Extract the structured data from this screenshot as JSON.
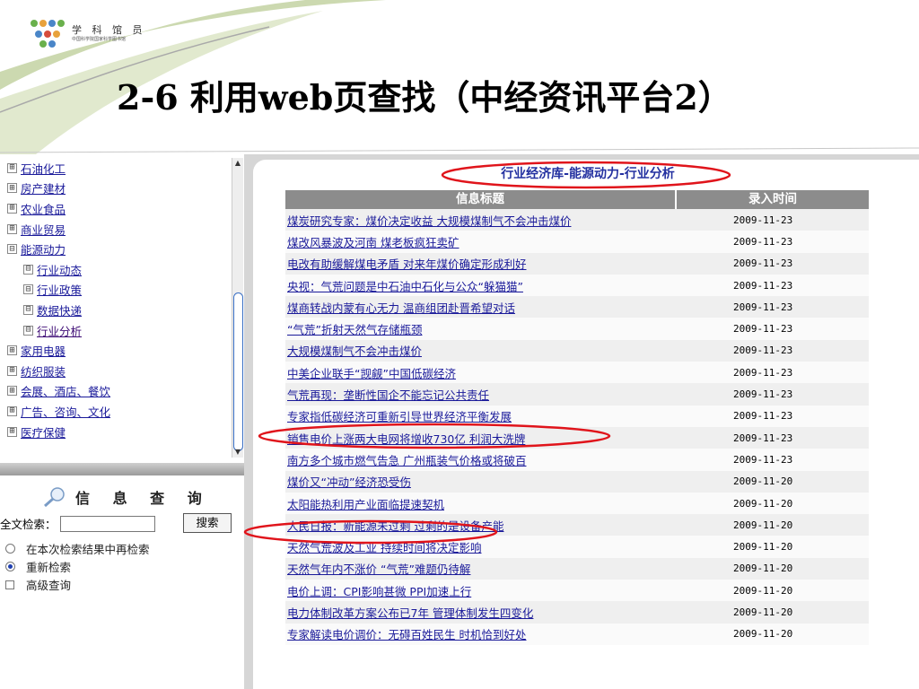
{
  "logo": {
    "title": "学 科 馆 员",
    "subtitle": "中国科学院国家科学图书馆"
  },
  "slide_title": "2-6 利用web页查找（中经资讯平台2）",
  "tree": [
    {
      "label": "石油化工",
      "toggle": "⊞",
      "level": 0
    },
    {
      "label": "房产建材",
      "toggle": "⊞",
      "level": 0
    },
    {
      "label": "农业食品",
      "toggle": "⊞",
      "level": 0
    },
    {
      "label": "商业贸易",
      "toggle": "⊞",
      "level": 0
    },
    {
      "label": "能源动力",
      "toggle": "⊟",
      "level": 0
    },
    {
      "label": "行业动态",
      "toggle": "⊟",
      "level": 1
    },
    {
      "label": "行业政策",
      "toggle": "⊟",
      "level": 1
    },
    {
      "label": "数据快递",
      "toggle": "⊟",
      "level": 1
    },
    {
      "label": "行业分析",
      "toggle": "⊟",
      "level": 1
    },
    {
      "label": "家用电器",
      "toggle": "⊞",
      "level": 0
    },
    {
      "label": "纺织服装",
      "toggle": "⊞",
      "level": 0
    },
    {
      "label": "会展、酒店、餐饮",
      "toggle": "⊞",
      "level": 0
    },
    {
      "label": "广告、咨询、文化",
      "toggle": "⊞",
      "level": 0
    },
    {
      "label": "医疗保健",
      "toggle": "⊞",
      "level": 0
    }
  ],
  "search": {
    "heading": "信 息 查 询",
    "label": "全文检索：",
    "value": "",
    "button": "搜索",
    "options": [
      "在本次检索结果中再检索",
      "重新检索",
      "高级查询"
    ]
  },
  "panel": {
    "title": "行业经济库-能源动力-行业分析"
  },
  "table": {
    "headers": [
      "信息标题",
      "录入时间"
    ],
    "rows": [
      {
        "title": "煤炭研究专家：煤价决定收益 大规模煤制气不会冲击煤价",
        "date": "2009-11-23"
      },
      {
        "title": "煤改风暴波及河南 煤老板疯狂卖矿",
        "date": "2009-11-23"
      },
      {
        "title": "电改有助缓解煤电矛盾 对来年煤价确定形成利好",
        "date": "2009-11-23"
      },
      {
        "title": "央视：气荒问题是中石油中石化与公众“躲猫猫”",
        "date": "2009-11-23"
      },
      {
        "title": "煤商转战内蒙有心无力 温商组团赴晋希望对话",
        "date": "2009-11-23"
      },
      {
        "title": "“气荒”折射天然气存储瓶颈",
        "date": "2009-11-23"
      },
      {
        "title": "大规模煤制气不会冲击煤价",
        "date": "2009-11-23"
      },
      {
        "title": "中美企业联手“觊觎”中国低碳经济",
        "date": "2009-11-23"
      },
      {
        "title": "气荒再现：垄断性国企不能忘记公共责任",
        "date": "2009-11-23"
      },
      {
        "title": "专家指低碳经济可重新引导世界经济平衡发展",
        "date": "2009-11-23"
      },
      {
        "title": "销售电价上涨两大电网将增收730亿 利润大洗牌",
        "date": "2009-11-23"
      },
      {
        "title": "南方多个城市燃气告急 广州瓶装气价格或将破百",
        "date": "2009-11-23"
      },
      {
        "title": "煤价又“冲动”经济恐受伤",
        "date": "2009-11-20"
      },
      {
        "title": "太阳能热利用产业面临提速契机",
        "date": "2009-11-20"
      },
      {
        "title": "人民日报：新能源未过剩 过剩的是设备产能",
        "date": "2009-11-20"
      },
      {
        "title": "天然气荒波及工业 持续时间将决定影响",
        "date": "2009-11-20"
      },
      {
        "title": "天然气年内不涨价 “气荒”难题仍待解",
        "date": "2009-11-20"
      },
      {
        "title": "电价上调：CPI影响甚微 PPI加速上行",
        "date": "2009-11-20"
      },
      {
        "title": "电力体制改革方案公布已7年 管理体制发生四变化",
        "date": "2009-11-20"
      },
      {
        "title": "专家解读电价调价：无碍百姓民生 时机恰到好处",
        "date": "2009-11-20"
      }
    ]
  },
  "colors": {
    "highlight": "#e0141b",
    "link": "#1a1a9a",
    "header_bg": "#8c8c8c",
    "deco_green": "#c6d4a4"
  }
}
